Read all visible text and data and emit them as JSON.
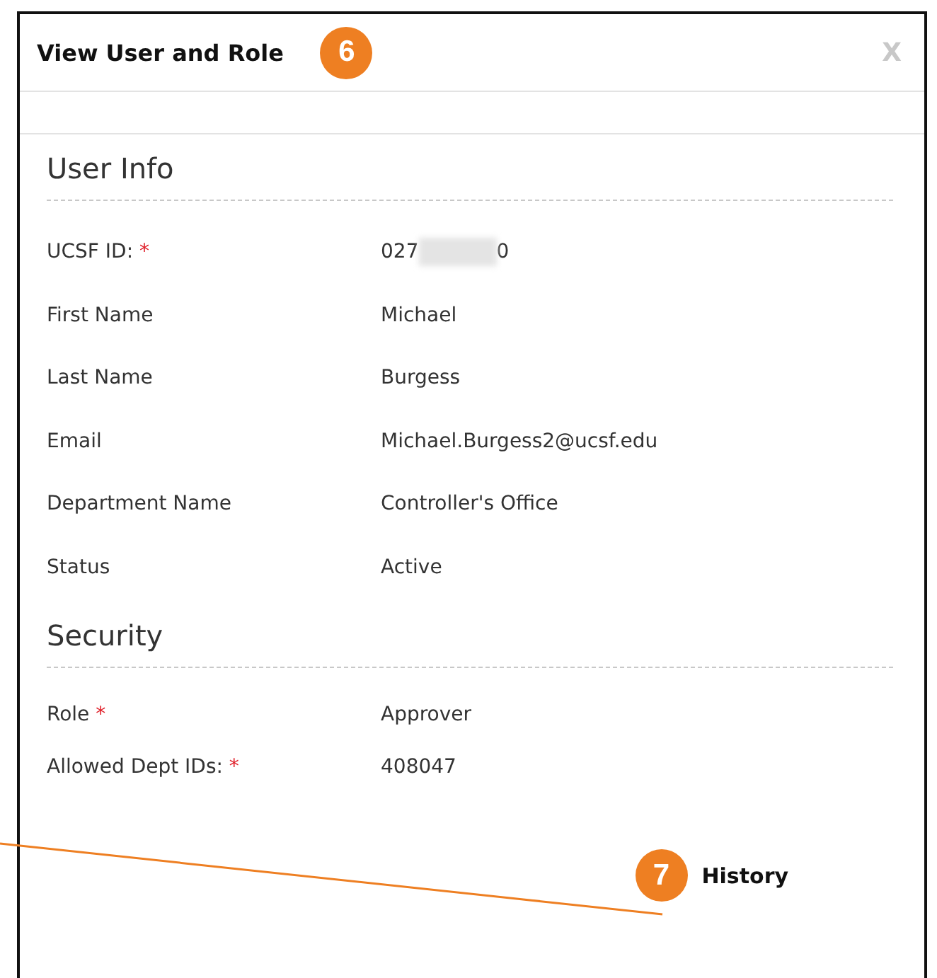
{
  "dialog": {
    "title": "View User and Role",
    "title_badge": "6",
    "close": "X"
  },
  "sections": [
    {
      "heading": "User Info",
      "fields": [
        {
          "label": "UCSF ID:",
          "required_mark": "*",
          "value": "027",
          "redacted": true,
          "value_end": "0"
        },
        {
          "label": "First Name",
          "value": "Michael"
        },
        {
          "label": "Last Name",
          "value": "Burgess"
        },
        {
          "label": "Email",
          "value": "Michael.Burgess2@ucsf.edu"
        },
        {
          "label": "Department Name",
          "value": "Controller's Office"
        },
        {
          "label": "Status",
          "value": "Active"
        }
      ]
    },
    {
      "heading": "Security",
      "fields": [
        {
          "label": "Role",
          "required_mark": "*",
          "value": "Approver"
        },
        {
          "label": "Allowed Dept IDs:",
          "required_mark": "*",
          "value": "408047"
        }
      ]
    }
  ],
  "history": {
    "badge": "7",
    "label": "History"
  }
}
